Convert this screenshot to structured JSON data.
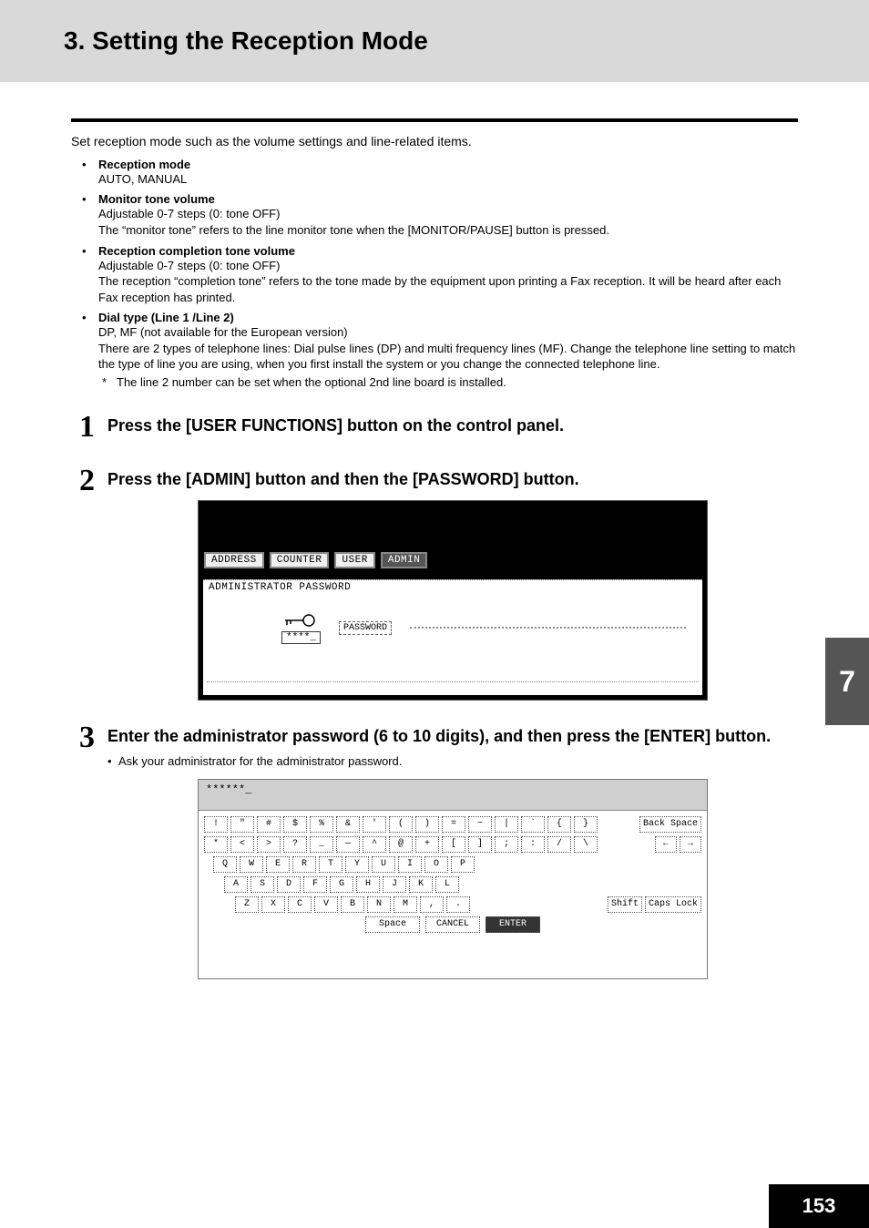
{
  "header": {
    "title": "3. Setting the Reception Mode"
  },
  "intro": "Set reception mode such as the volume settings and line-related items.",
  "items": [
    {
      "label": "Reception mode",
      "lines": [
        "AUTO, MANUAL"
      ]
    },
    {
      "label": "Monitor tone volume",
      "lines": [
        "Adjustable 0-7 steps (0: tone OFF)",
        "The “monitor tone” refers to the line monitor tone when the [MONITOR/PAUSE] button is pressed."
      ]
    },
    {
      "label": "Reception completion tone volume",
      "lines": [
        "Adjustable 0-7 steps (0: tone OFF)",
        "The reception “completion tone” refers to the tone made by the equipment upon printing a Fax reception. It will be heard after each Fax reception has printed."
      ]
    },
    {
      "label": "Dial type (Line 1 /Line 2)",
      "lines": [
        "DP, MF (not available for the European version)",
        "There are 2 types of telephone lines: Dial pulse lines (DP) and multi frequency lines (MF). Change the telephone line setting to match the type of line you are using, when you first install the system or you change the connected telephone line."
      ],
      "star": "The line 2 number can be set when the optional 2nd line board is installed."
    }
  ],
  "steps": {
    "s1": {
      "num": "1",
      "title": "Press the [USER FUNCTIONS] button on the control panel."
    },
    "s2": {
      "num": "2",
      "title": "Press the [ADMIN] button and then the [PASSWORD] button."
    },
    "s3": {
      "num": "3",
      "title": "Enter the administrator password (6 to 10 digits), and then press the [ENTER] button.",
      "sub": "Ask your administrator for the administrator password."
    }
  },
  "screen1": {
    "tabs": [
      "ADDRESS",
      "COUNTER",
      "USER",
      "ADMIN"
    ],
    "active_tab_index": 3,
    "panel_title": "ADMINISTRATOR PASSWORD",
    "mask": "****_",
    "pwd_button": "PASSWORD"
  },
  "screen2": {
    "top_mask": "******_",
    "row1": [
      "!",
      "\"",
      "#",
      "$",
      "%",
      "&",
      "'",
      "(",
      ")",
      "=",
      "~",
      "|",
      "`",
      "{",
      "}"
    ],
    "row1_right": "Back Space",
    "row2": [
      "*",
      "<",
      ">",
      "?",
      "_",
      "—",
      "^",
      "@",
      "+",
      "[",
      "]",
      ";",
      ":",
      "/",
      "\\"
    ],
    "row2_right": [
      "←",
      "→"
    ],
    "row3": [
      "Q",
      "W",
      "E",
      "R",
      "T",
      "Y",
      "U",
      "I",
      "O",
      "P"
    ],
    "row4": [
      "A",
      "S",
      "D",
      "F",
      "G",
      "H",
      "J",
      "K",
      "L"
    ],
    "row5": [
      "Z",
      "X",
      "C",
      "V",
      "B",
      "N",
      "M",
      ",",
      "."
    ],
    "row5_right": [
      "Shift",
      "Caps Lock"
    ],
    "bottom": [
      "Space",
      "CANCEL",
      "ENTER"
    ]
  },
  "side_tab": "7",
  "page_number": "153"
}
